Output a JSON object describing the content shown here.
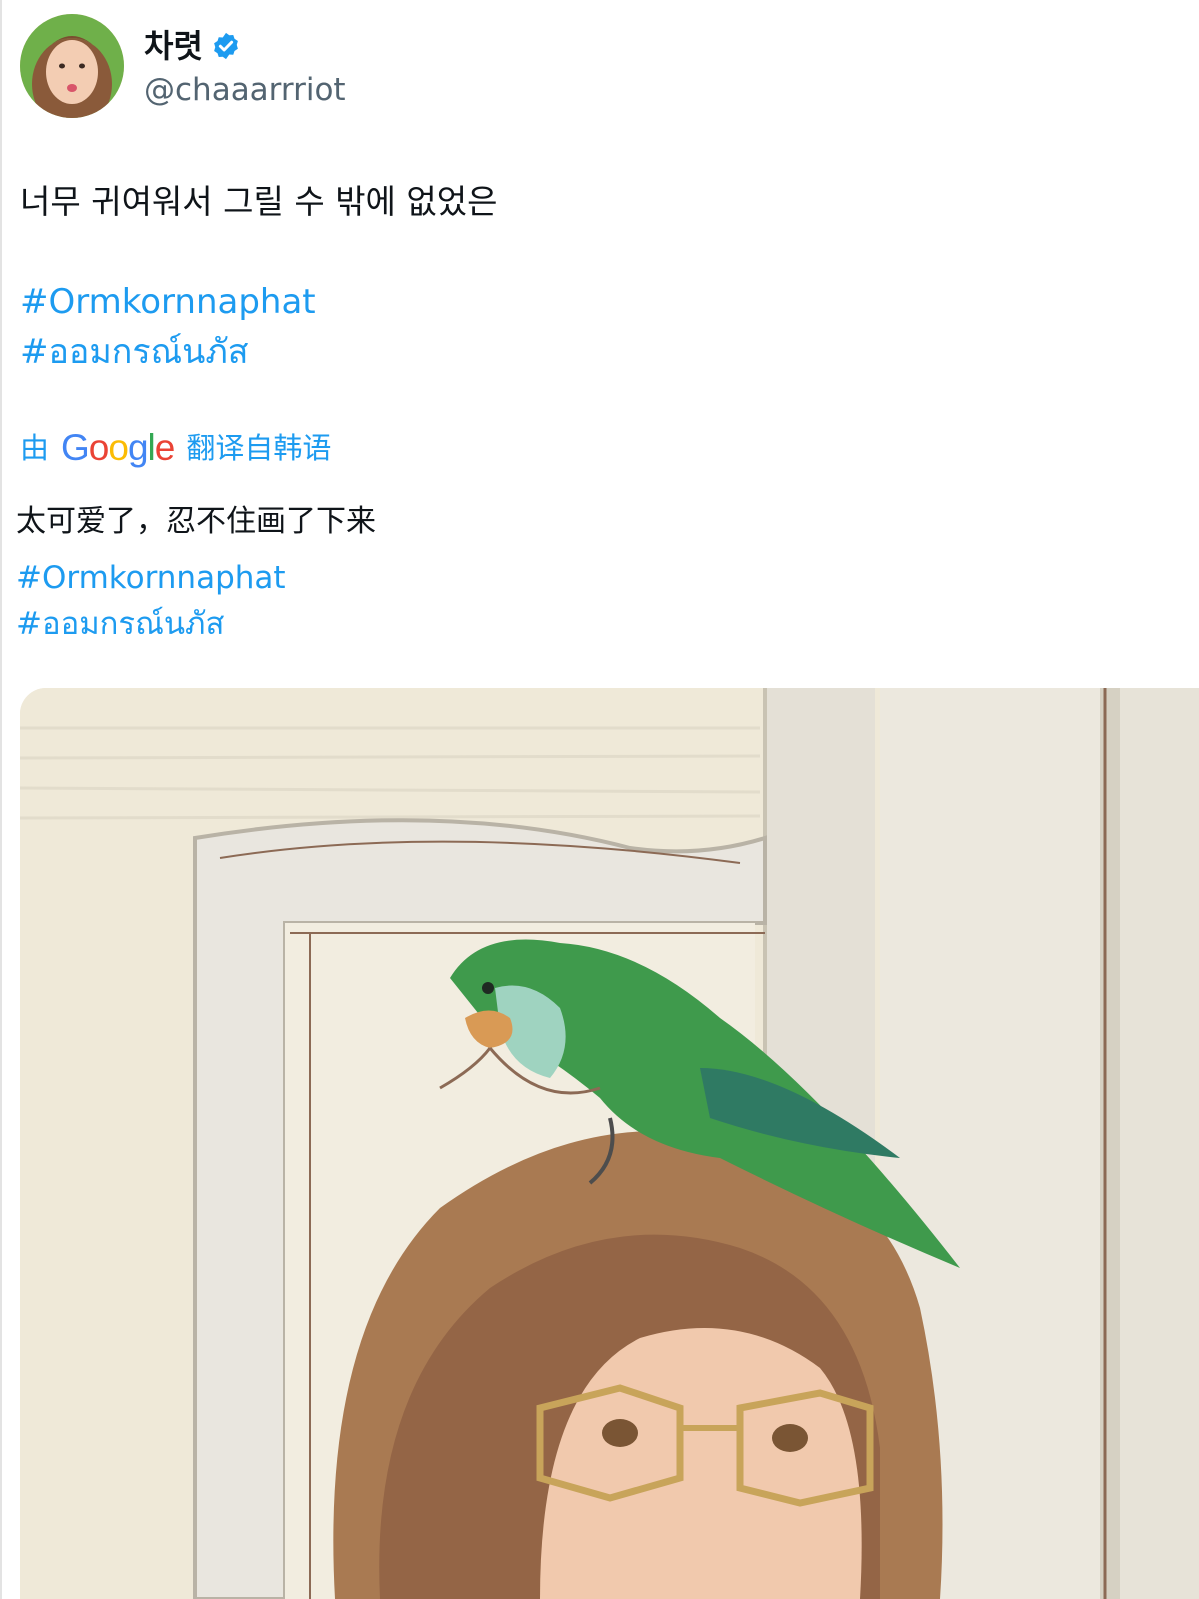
{
  "author": {
    "display_name": "차렷",
    "handle": "@chaaarrriot",
    "verified_icon": "verified-badge-icon",
    "avatar_icon": "profile-avatar"
  },
  "tweet": {
    "text": "너무 귀여워서 그릴 수 밖에 없었은",
    "hashtags": [
      "#Ormkornnaphat",
      "#ออมกรณ์นภัส"
    ]
  },
  "translation": {
    "prefix": "由",
    "logo_letters": [
      "G",
      "o",
      "o",
      "g",
      "l",
      "e"
    ],
    "suffix": "翻译自韩语",
    "text": "太可爱了，忍不住画了下来",
    "hashtags": [
      "#Ormkornnaphat",
      "#ออมกรณ์นภัส"
    ]
  },
  "colors": {
    "link": "#1d9bf0",
    "secondary_text": "#536471",
    "verified": "#1d9bf0",
    "google_blue": "#4285F4",
    "google_red": "#EA4335",
    "google_yellow": "#FBBC05",
    "google_green": "#34A853"
  },
  "media": {
    "type": "illustration",
    "subject_icons": [
      "parrot-illustration",
      "person-with-glasses-illustration"
    ]
  }
}
